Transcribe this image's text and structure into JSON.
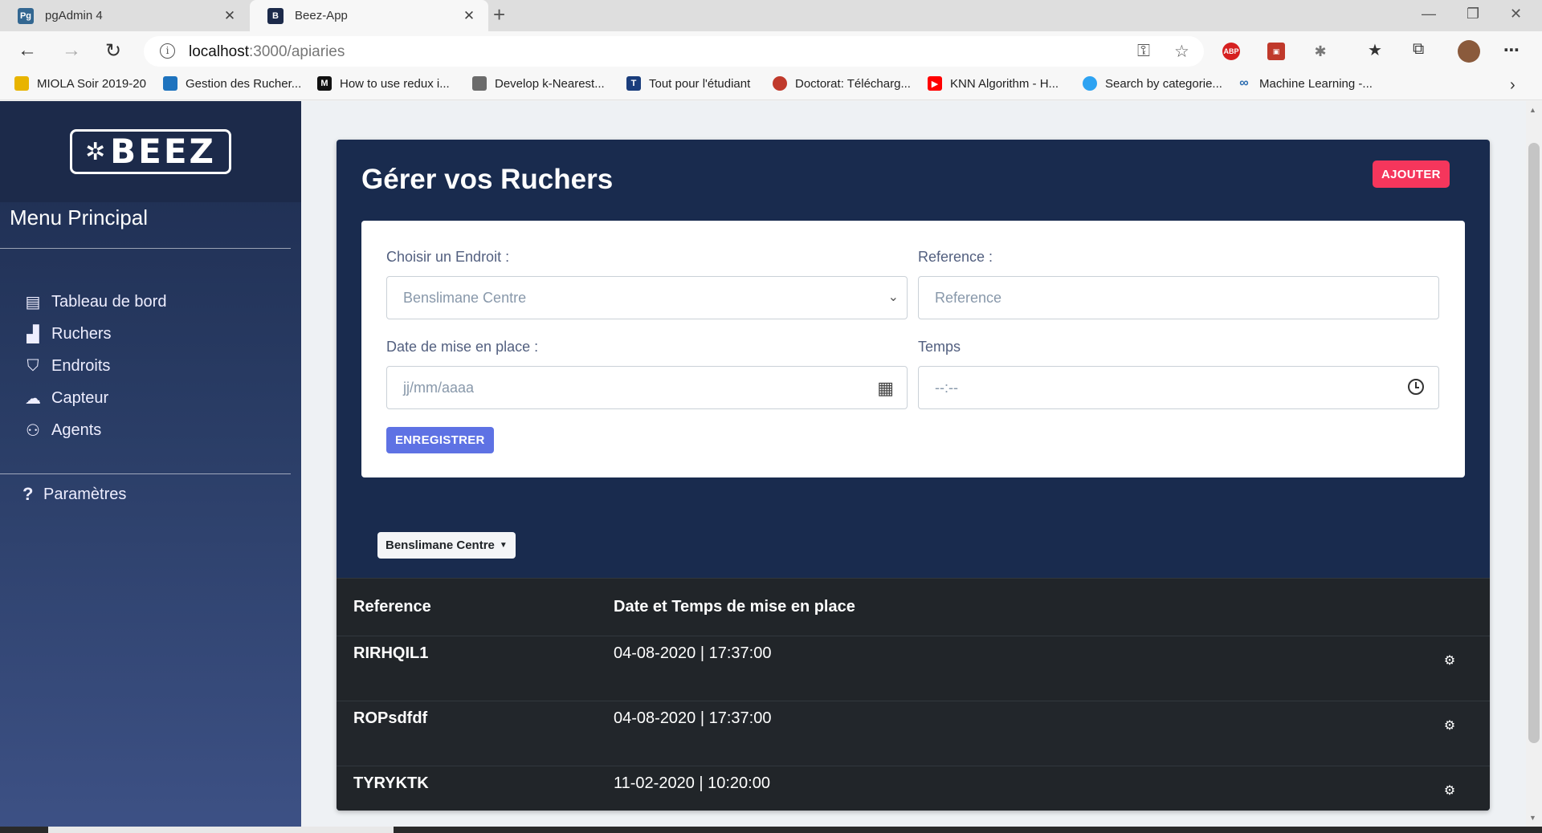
{
  "browser": {
    "tabs": [
      {
        "title": "pgAdmin 4",
        "icon": "pgadmin-icon",
        "fav_text": "Pg"
      },
      {
        "title": "Beez-App",
        "icon": "beez-icon",
        "fav_text": "B"
      }
    ],
    "url_host": "localhost",
    "url_path": ":3000/apiaries",
    "bookmarks": [
      {
        "label": "MIOLA Soir 2019-20",
        "color": "#e8b400"
      },
      {
        "label": "Gestion des Rucher...",
        "color": "#1e73be"
      },
      {
        "label": "How to use redux i...",
        "color": "#111111",
        "glyph": "M"
      },
      {
        "label": "Develop k-Nearest...",
        "color": "#6b6b6b"
      },
      {
        "label": "Tout pour l'étudiant",
        "color": "#1a3d7c",
        "glyph": "T"
      },
      {
        "label": "Doctorat: Télécharg...",
        "color": "#c0392b"
      },
      {
        "label": "KNN Algorithm - H...",
        "color": "#ff0000"
      },
      {
        "label": "Search by categorie...",
        "color": "#2ea3f2"
      },
      {
        "label": "Machine Learning -...",
        "color": "#2b6cb0"
      }
    ]
  },
  "sidebar": {
    "menu_title": "Menu Principal",
    "items": [
      {
        "label": "Tableau de bord",
        "icon": "dashboard-icon"
      },
      {
        "label": "Ruchers",
        "icon": "hives-icon"
      },
      {
        "label": "Endroits",
        "icon": "map-marker-icon"
      },
      {
        "label": "Capteur",
        "icon": "cloud-icon"
      },
      {
        "label": "Agents",
        "icon": "users-icon"
      }
    ],
    "settings_label": "Paramètres"
  },
  "main": {
    "title": "Gérer vos Ruchers",
    "add_button": "AJOUTER",
    "form": {
      "location_label": "Choisir un Endroit :",
      "location_value": "Benslimane Centre",
      "reference_label": "Reference :",
      "reference_placeholder": "Reference",
      "date_label": "Date de mise en place :",
      "date_placeholder": "jj/mm/aaaa",
      "time_label": "Temps",
      "time_placeholder": "--:--",
      "save_button": "ENREGISTRER"
    },
    "filter_dropdown": "Benslimane Centre",
    "table": {
      "headers": [
        "Reference",
        "Date et Temps de mise en place"
      ],
      "rows": [
        {
          "reference": "RIRHQIL1",
          "datetime": "04-08-2020 | 17:37:00"
        },
        {
          "reference": "ROPsdfdf",
          "datetime": "04-08-2020 | 17:37:00"
        },
        {
          "reference": "TYRYKTK",
          "datetime": "11-02-2020 | 10:20:00"
        }
      ]
    }
  },
  "colors": {
    "sidebar_top": "#1d2c4f",
    "card_bg": "#192b4e",
    "danger": "#f5365c",
    "primary": "#5e72e4",
    "table_dark": "#212529"
  }
}
